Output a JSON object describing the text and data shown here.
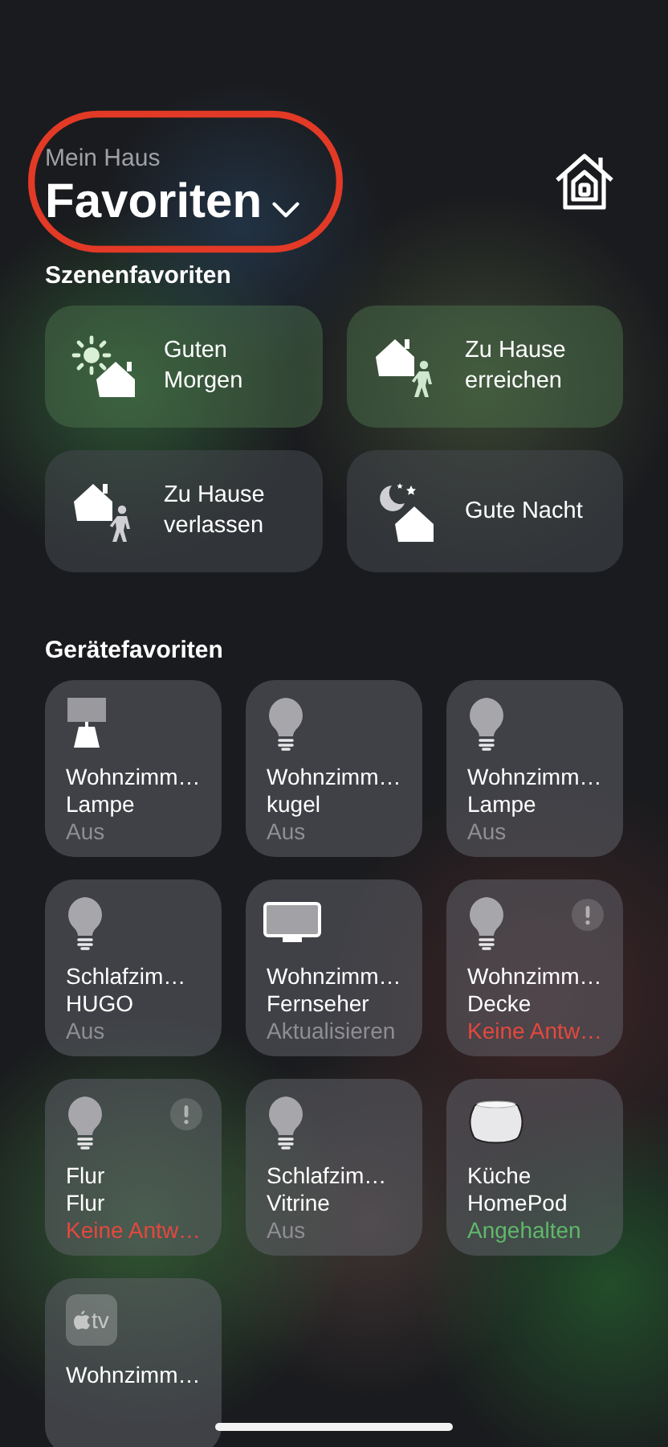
{
  "header": {
    "subtitle": "Mein Haus",
    "title": "Favoriten",
    "circled": true
  },
  "scenes": {
    "title": "Szenenfavoriten",
    "items": [
      {
        "kind": "morning",
        "label": "Guten Morgen",
        "active": true
      },
      {
        "kind": "arrive",
        "label": "Zu Hause erreichen",
        "active": true
      },
      {
        "kind": "leave",
        "label": "Zu Hause verlassen",
        "active": false
      },
      {
        "kind": "night",
        "label": "Gute Nacht",
        "active": false
      }
    ]
  },
  "devices": {
    "title": "Gerätefavoriten",
    "items": [
      {
        "kind": "lamp",
        "room": "Wohnzimm…",
        "name": "Lampe",
        "status": "Aus",
        "color": "#8e8e93",
        "alert": false
      },
      {
        "kind": "bulb",
        "room": "Wohnzimm…",
        "name": "kugel",
        "status": "Aus",
        "color": "#8e8e93",
        "alert": false
      },
      {
        "kind": "bulb",
        "room": "Wohnzimm…",
        "name": "Lampe",
        "status": "Aus",
        "color": "#8e8e93",
        "alert": false
      },
      {
        "kind": "bulb",
        "room": "Schlafzim…",
        "name": "HUGO",
        "status": "Aus",
        "color": "#8e8e93",
        "alert": false
      },
      {
        "kind": "tv",
        "room": "Wohnzimm…",
        "name": "Fernseher",
        "status": "Aktualisieren",
        "color": "#8e8e93",
        "alert": false
      },
      {
        "kind": "bulb",
        "room": "Wohnzimm…",
        "name": "Decke",
        "status": "Keine Antw…",
        "color": "#e5483e",
        "alert": true
      },
      {
        "kind": "bulb",
        "room": "Flur",
        "name": "Flur",
        "status": "Keine Antw…",
        "color": "#e5483e",
        "alert": true
      },
      {
        "kind": "bulb",
        "room": "Schlafzim…",
        "name": "Vitrine",
        "status": "Aus",
        "color": "#8e8e93",
        "alert": false
      },
      {
        "kind": "homepod",
        "room": "Küche",
        "name": "HomePod",
        "status": "Angehalten",
        "color": "#5fb96a",
        "alert": false
      },
      {
        "kind": "appletv",
        "room": "Wohnzimm…",
        "icon_text": "tv"
      }
    ]
  }
}
